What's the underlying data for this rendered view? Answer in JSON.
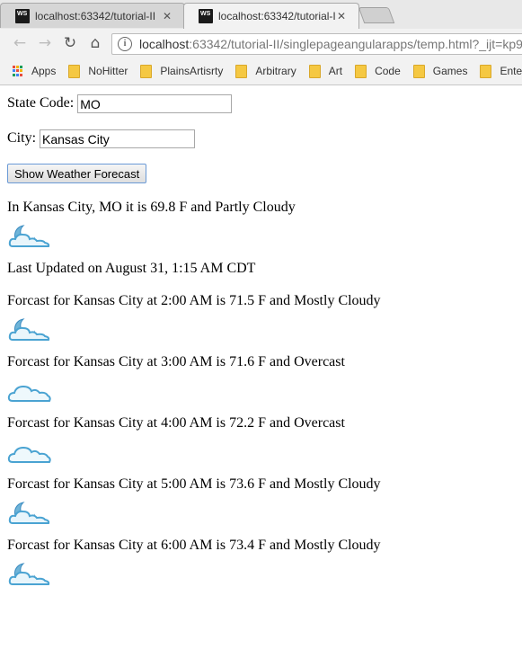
{
  "browser": {
    "tabs": [
      {
        "title": "localhost:63342/tutorial-II",
        "active": false
      },
      {
        "title": "localhost:63342/tutorial-II",
        "active": true
      }
    ],
    "url_host": "localhost",
    "url_path": ":63342/tutorial-II/singlepageangularapps/temp.html?_ijt=kp9",
    "bookmarks": [
      "Apps",
      "NoHitter",
      "PlainsArtisrty",
      "Arbitrary",
      "Art",
      "Code",
      "Games",
      "Ente"
    ]
  },
  "form": {
    "state_label": "State Code:",
    "state_value": "MO",
    "city_label": "City:",
    "city_value": "Kansas City",
    "submit_label": "Show Weather Forecast"
  },
  "current": {
    "text": "In Kansas City, MO it is 69.8 F and Partly Cloudy",
    "icon": "partly-cloudy-night-icon",
    "updated": "Last Updated on August 31, 1:15 AM CDT"
  },
  "forecasts": [
    {
      "text": "Forcast for Kansas City at 2:00 AM is 71.5 F and Mostly Cloudy",
      "icon": "mostly-cloudy-night-icon"
    },
    {
      "text": "Forcast for Kansas City at 3:00 AM is 71.6 F and Overcast",
      "icon": "overcast-icon"
    },
    {
      "text": "Forcast for Kansas City at 4:00 AM is 72.2 F and Overcast",
      "icon": "overcast-icon"
    },
    {
      "text": "Forcast for Kansas City at 5:00 AM is 73.6 F and Mostly Cloudy",
      "icon": "mostly-cloudy-night-icon"
    },
    {
      "text": "Forcast for Kansas City at 6:00 AM is 73.4 F and Mostly Cloudy",
      "icon": "mostly-cloudy-night-icon"
    }
  ]
}
